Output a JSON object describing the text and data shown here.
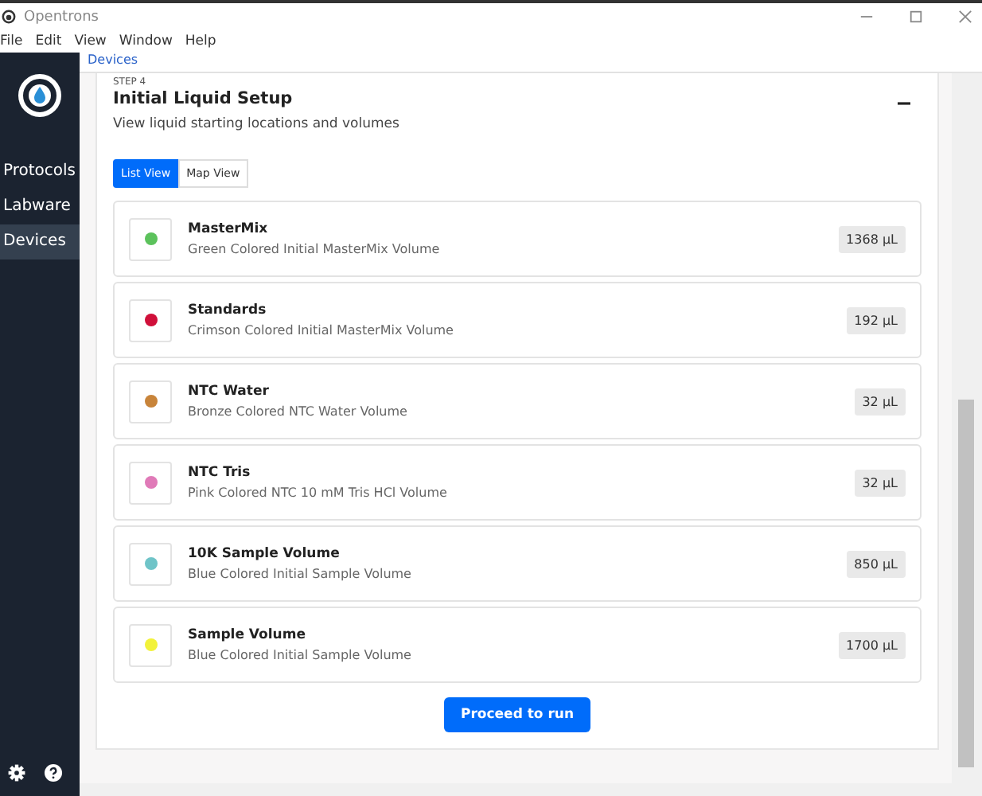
{
  "window": {
    "title": "Opentrons"
  },
  "menu": [
    "File",
    "Edit",
    "View",
    "Window",
    "Help"
  ],
  "sidebar": {
    "items": [
      {
        "label": "Protocols",
        "selected": false
      },
      {
        "label": "Labware",
        "selected": false
      },
      {
        "label": "Devices",
        "selected": true
      }
    ]
  },
  "breadcrumb": "Devices",
  "step": {
    "label": "STEP 4",
    "title": "Initial Liquid Setup",
    "description": "View liquid starting locations and volumes",
    "expanded": true
  },
  "views": [
    {
      "label": "List View",
      "selected": true
    },
    {
      "label": "Map View",
      "selected": false
    }
  ],
  "liquids": [
    {
      "name": "MasterMix",
      "description": "Green Colored Initial MasterMix Volume",
      "volume": "1368 µL",
      "color": "#5cc25c"
    },
    {
      "name": "Standards",
      "description": "Crimson Colored Initial MasterMix Volume",
      "volume": "192 µL",
      "color": "#d0103a"
    },
    {
      "name": "NTC Water",
      "description": "Bronze Colored NTC Water Volume",
      "volume": "32 µL",
      "color": "#c8843a"
    },
    {
      "name": "NTC Tris",
      "description": "Pink Colored NTC 10 mM Tris HCl Volume",
      "volume": "32 µL",
      "color": "#e07ab8"
    },
    {
      "name": "10K Sample Volume",
      "description": "Blue Colored Initial Sample Volume",
      "volume": "850 µL",
      "color": "#6fc4c8"
    },
    {
      "name": "Sample Volume",
      "description": "Blue Colored Initial Sample Volume",
      "volume": "1700 µL",
      "color": "#f2f23a"
    }
  ],
  "button": "Proceed to run"
}
